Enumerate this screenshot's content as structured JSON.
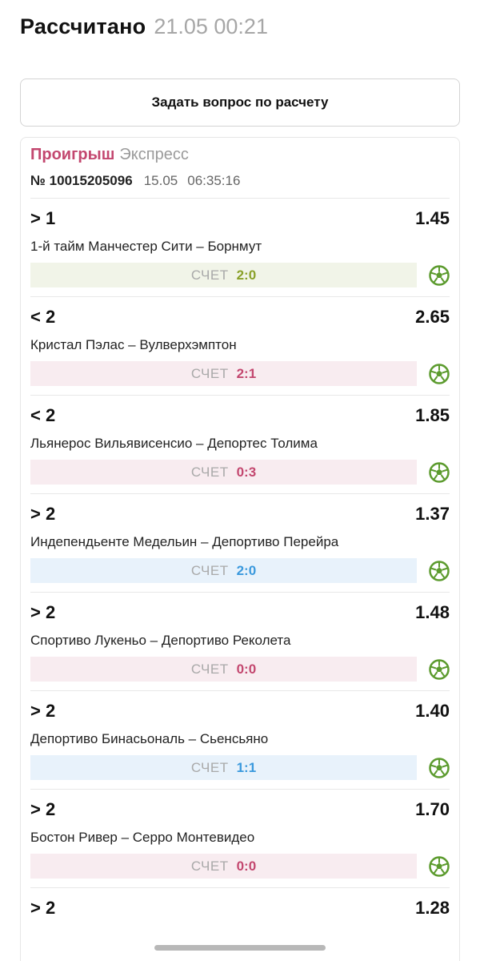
{
  "header": {
    "title": "Рассчитано",
    "timestamp": "21.05 00:21"
  },
  "ask_button": {
    "label": "Задать вопрос по расчету"
  },
  "ticket": {
    "status": "Проигрыш",
    "type": "Экспресс",
    "number": "№ 10015205096",
    "date": "15.05",
    "time": "06:35:16",
    "score_label": "СЧЕТ",
    "bets": [
      {
        "market": "> 1",
        "odds": "1.45",
        "match": "1-й тайм Манчестер Сити – Борнмут",
        "score": "2:0",
        "result": "green"
      },
      {
        "market": "< 2",
        "odds": "2.65",
        "match": "Кристал Пэлас – Вулверхэмптон",
        "score": "2:1",
        "result": "red"
      },
      {
        "market": "< 2",
        "odds": "1.85",
        "match": "Льянерос Вильявисенсио – Депортес Толима",
        "score": "0:3",
        "result": "red"
      },
      {
        "market": "> 2",
        "odds": "1.37",
        "match": "Индепендьенте Медельин – Депортиво Перейра",
        "score": "2:0",
        "result": "blue"
      },
      {
        "market": "> 2",
        "odds": "1.48",
        "match": "Спортиво Лукеньо – Депортиво Реколета",
        "score": "0:0",
        "result": "red"
      },
      {
        "market": "> 2",
        "odds": "1.40",
        "match": "Депортиво Бинасьональ – Сьенсьяно",
        "score": "1:1",
        "result": "blue"
      },
      {
        "market": "> 2",
        "odds": "1.70",
        "match": "Бостон Ривер – Серро Монтевидео",
        "score": "0:0",
        "result": "red"
      },
      {
        "market": "> 2",
        "odds": "1.28",
        "match": "",
        "score": "",
        "result": ""
      }
    ]
  },
  "icons": {
    "sport": "soccer-ball-icon"
  },
  "colors": {
    "lose": "#c3476f",
    "win": "#8aa12a",
    "return": "#3a99dd",
    "sport_icon": "#5c9b2e"
  }
}
